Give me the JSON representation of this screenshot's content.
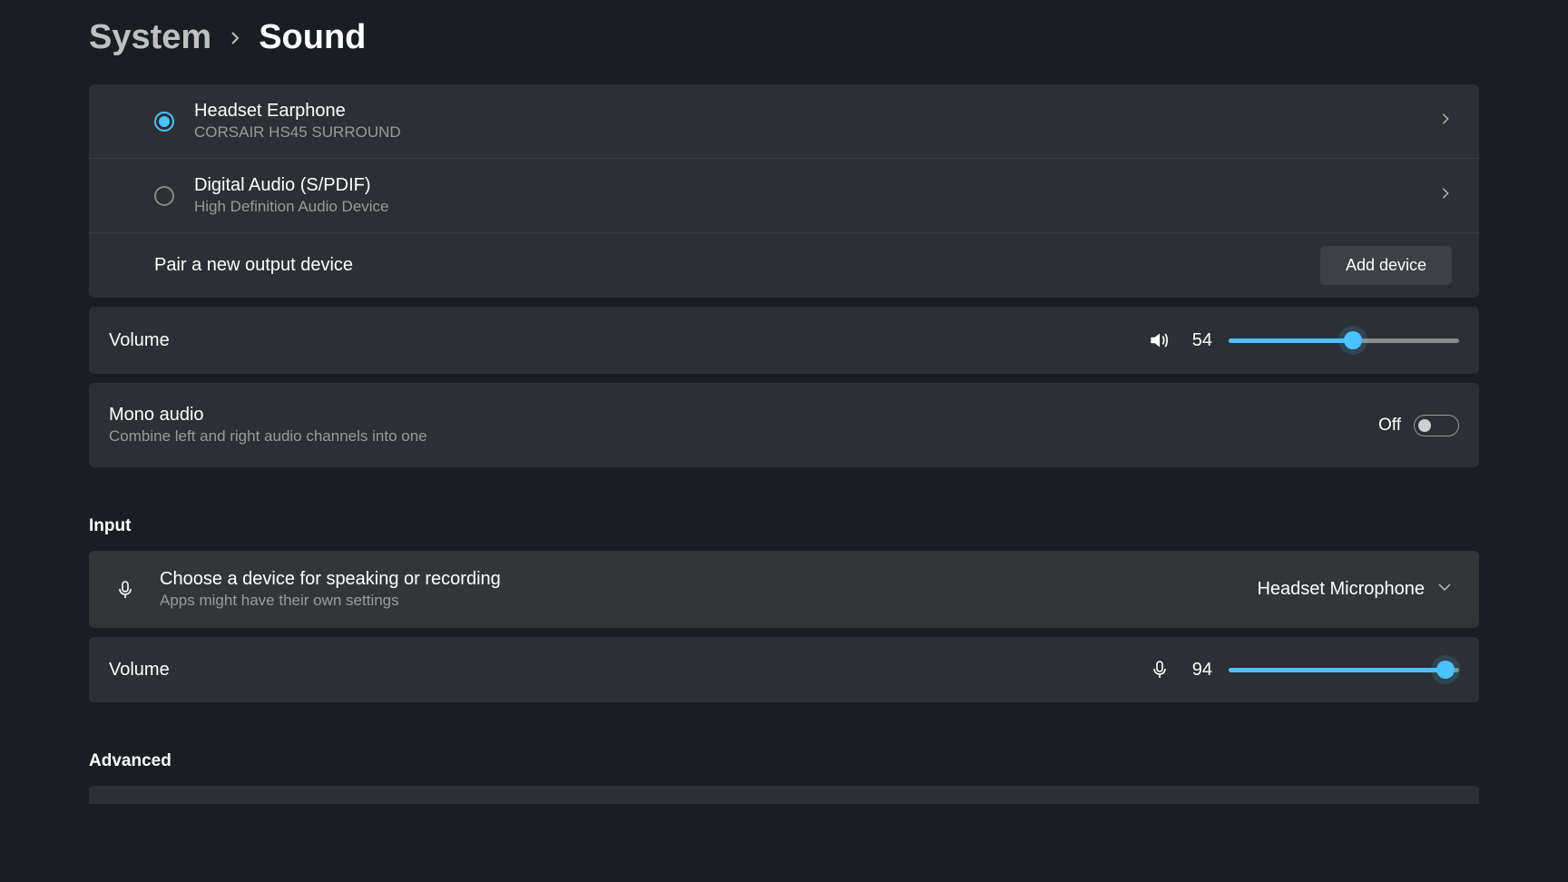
{
  "breadcrumb": {
    "parent": "System",
    "current": "Sound"
  },
  "output": {
    "devices": [
      {
        "title": "Headset Earphone",
        "subtitle": "CORSAIR HS45 SURROUND",
        "selected": true
      },
      {
        "title": "Digital Audio (S/PDIF)",
        "subtitle": "High Definition Audio Device",
        "selected": false
      }
    ],
    "pair_label": "Pair a new output device",
    "add_button": "Add device",
    "volume": {
      "label": "Volume",
      "value": "54",
      "percent": 54
    },
    "mono": {
      "label": "Mono audio",
      "sub": "Combine left and right audio channels into one",
      "state": "Off"
    }
  },
  "input": {
    "header": "Input",
    "choose": {
      "title": "Choose a device for speaking or recording",
      "sub": "Apps might have their own settings",
      "selected": "Headset Microphone"
    },
    "volume": {
      "label": "Volume",
      "value": "94",
      "percent": 94
    }
  },
  "advanced": {
    "header": "Advanced"
  }
}
